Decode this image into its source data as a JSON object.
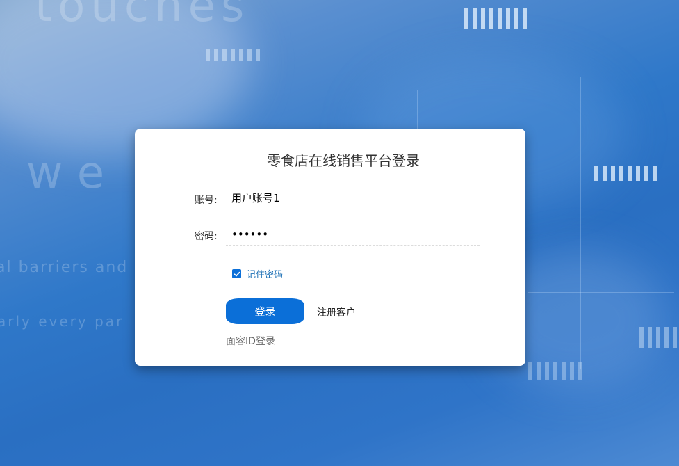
{
  "background": {
    "texts": [
      "touches",
      "w e",
      "al barriers and",
      "arly every par"
    ],
    "colors": {
      "primary": "#2f78c9"
    }
  },
  "login": {
    "title": "零食店在线销售平台登录",
    "account": {
      "label": "账号:",
      "value": "用户账号1"
    },
    "password": {
      "label": "密码:",
      "value": "123456"
    },
    "remember": {
      "label": "记住密码",
      "checked": true
    },
    "login_button": "登录",
    "register_link": "注册客户",
    "face_login": "面容ID登录"
  },
  "colors": {
    "accent": "#0b6fd8",
    "card": "#ffffff",
    "title": "#333333"
  },
  "icons": {
    "checkbox": "check-icon"
  }
}
